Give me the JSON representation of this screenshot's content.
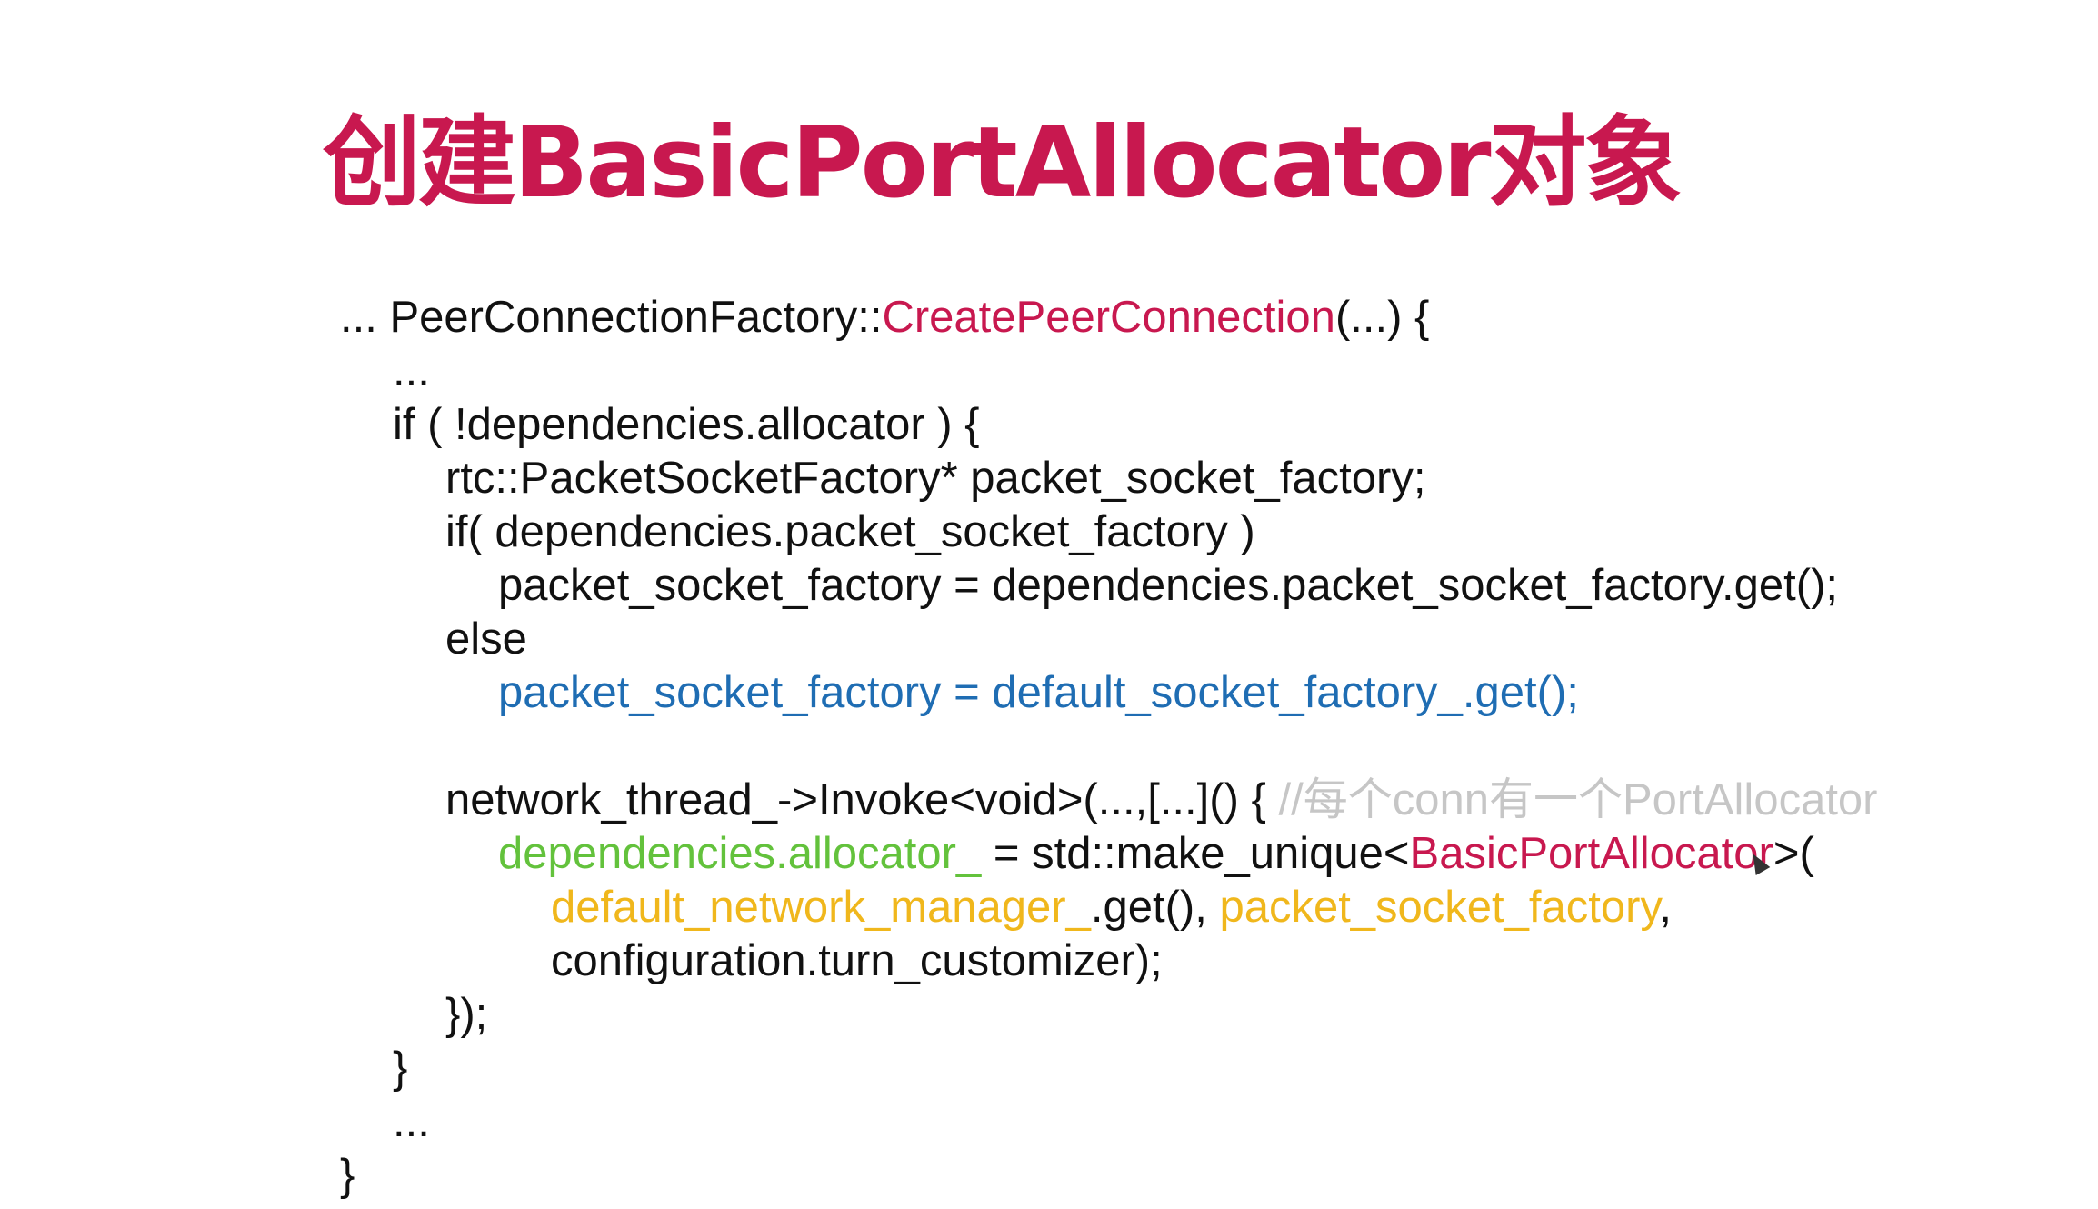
{
  "title": "创建BasicPortAllocator对象",
  "code": {
    "l1": {
      "a": "... PeerConnectionFactory::",
      "b": "CreatePeerConnection",
      "c": "(...) {"
    },
    "l2": "...",
    "l3": "if ( !dependencies.allocator ) {",
    "l4": "rtc::PacketSocketFactory* packet_socket_factory;",
    "l5": "if( dependencies.packet_socket_factory )",
    "l6": "packet_socket_factory = dependencies.packet_socket_factory.get();",
    "l7": "else",
    "l8": "packet_socket_factory = default_socket_factory_.get();",
    "l10": {
      "a": "network_thread_->Invoke<void>(...,[...]() { ",
      "comment": "//每个conn有一个PortAllocator"
    },
    "l11": {
      "a": "dependencies.allocator_",
      "b": " = std::make_unique<",
      "c": "BasicPortAllocator",
      "d": ">("
    },
    "l12": {
      "a": "default_network_manager_",
      "b": ".get(), ",
      "c": "packet_socket_factory",
      "d": ","
    },
    "l13": "configuration.turn_customizer);",
    "l14": "});",
    "l15": "}",
    "l16": "...",
    "l17": "}"
  },
  "colors": {
    "title": "#c8184f",
    "function": "#c8184f",
    "highlight_blue": "#1f6db3",
    "highlight_green": "#63c23c",
    "highlight_orange": "#f0b71c",
    "comment": "#c6c6c6"
  },
  "icons": {
    "mouse_cursor": "mouse-pointer-icon"
  }
}
